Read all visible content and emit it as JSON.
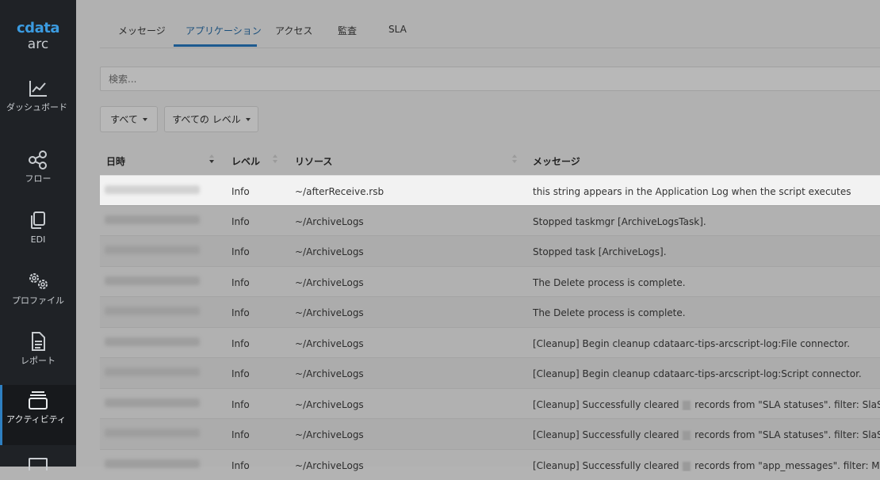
{
  "brand": {
    "top": "cdata",
    "bottom": "arc"
  },
  "sidebar": {
    "items": [
      {
        "label": "ダッシュボード",
        "icon": "chart-line-icon"
      },
      {
        "label": "フロー",
        "icon": "share-nodes-icon"
      },
      {
        "label": "EDI",
        "icon": "copy-icon"
      },
      {
        "label": "プロファイル",
        "icon": "gears-icon"
      },
      {
        "label": "レポート",
        "icon": "file-lines-icon"
      },
      {
        "label": "アクティビティ",
        "icon": "layer-group-icon"
      }
    ]
  },
  "tabs": [
    "メッセージ",
    "アプリケーション",
    "アクセス",
    "監査",
    "SLA"
  ],
  "search": {
    "placeholder": "検索..."
  },
  "filters": {
    "all": "すべて",
    "all_levels": "すべての レベル"
  },
  "table": {
    "headers": [
      "日時",
      "レベル",
      "リソース",
      "メッセージ"
    ],
    "rows": [
      {
        "level": "Info",
        "resource": "~/afterReceive.rsb",
        "message": "this string appears in the Application Log when the script executes"
      },
      {
        "level": "Info",
        "resource": "~/ArchiveLogs",
        "message": "Stopped taskmgr [ArchiveLogsTask]."
      },
      {
        "level": "Info",
        "resource": "~/ArchiveLogs",
        "message": "Stopped task [ArchiveLogs]."
      },
      {
        "level": "Info",
        "resource": "~/ArchiveLogs",
        "message": "The Delete process is complete."
      },
      {
        "level": "Info",
        "resource": "~/ArchiveLogs",
        "message": "The Delete process is complete."
      },
      {
        "level": "Info",
        "resource": "~/ArchiveLogs",
        "message": "[Cleanup] Begin cleanup cdataarc-tips-arcscript-log:File connector."
      },
      {
        "level": "Info",
        "resource": "~/ArchiveLogs",
        "message": "[Cleanup] Begin cleanup cdataarc-tips-arcscript-log:Script connector."
      },
      {
        "level": "Info",
        "resource": "~/ArchiveLogs",
        "message_a": "[Cleanup] Successfully cleared",
        "message_b": "records from \"SLA statuses\". filter: SlaStatusHistory"
      },
      {
        "level": "Info",
        "resource": "~/ArchiveLogs",
        "message_a": "[Cleanup] Successfully cleared",
        "message_b": "records from \"SLA statuses\". filter: SlaStatusHistory"
      },
      {
        "level": "Info",
        "resource": "~/ArchiveLogs",
        "message_a": "[Cleanup] Successfully cleared",
        "message_b": "records from \"app_messages\". filter: Messages"
      }
    ]
  }
}
